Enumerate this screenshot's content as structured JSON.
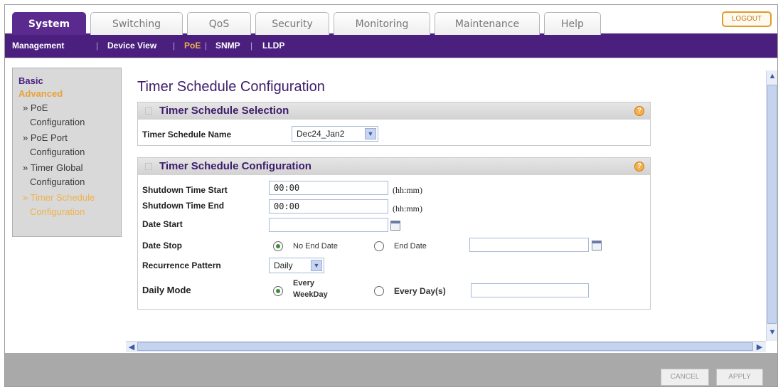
{
  "tabs": [
    {
      "label": "System",
      "active": true
    },
    {
      "label": "Switching"
    },
    {
      "label": "QoS"
    },
    {
      "label": "Security"
    },
    {
      "label": "Monitoring"
    },
    {
      "label": "Maintenance"
    },
    {
      "label": "Help"
    }
  ],
  "logout_label": "LOGOUT",
  "subnav": [
    "Management",
    "Device View",
    "PoE",
    "SNMP",
    "LLDP"
  ],
  "subnav_sep": "|",
  "leftmenu": {
    "basic": "Basic",
    "advanced": "Advanced",
    "items": [
      {
        "line1": "PoE",
        "line2": "Configuration"
      },
      {
        "line1": "PoE Port",
        "line2": "Configuration"
      },
      {
        "line1": "Timer Global",
        "line2": "Configuration"
      },
      {
        "line1": "Timer Schedule",
        "line2": "Configuration"
      }
    ],
    "bullet": "»"
  },
  "page_title": "Timer Schedule Configuration",
  "selection_panel": {
    "title": "Timer Schedule Selection",
    "name_label": "Timer Schedule Name",
    "name_value": "Dec24_Jan2"
  },
  "config_panel": {
    "title": "Timer Schedule Configuration",
    "shutdown_start_label": "Shutdown Time Start",
    "shutdown_start_value": "00:00",
    "shutdown_end_label": "Shutdown Time End",
    "shutdown_end_value": "00:00",
    "time_unit": "(hh:mm)",
    "date_start_label": "Date Start",
    "date_start_value": "",
    "date_stop_label": "Date Stop",
    "no_end_date": "No End Date",
    "end_date": "End Date",
    "end_date_value": "",
    "recurrence_label": "Recurrence Pattern",
    "recurrence_value": "Daily",
    "daily_mode_label": "Daily Mode",
    "every_weekday_1": "Every",
    "every_weekday_2": "WeekDay",
    "every_days": "Every Day(s)",
    "every_days_value": ""
  },
  "help_glyph": "?",
  "scroll": {
    "up": "▲",
    "down": "▼",
    "left": "◀",
    "right": "▶"
  },
  "footer": {
    "cancel": "CANCEL",
    "apply": "APPLY"
  },
  "colors": {
    "brand_purple": "#4a1f7e",
    "accent_orange": "#f0b24a"
  }
}
